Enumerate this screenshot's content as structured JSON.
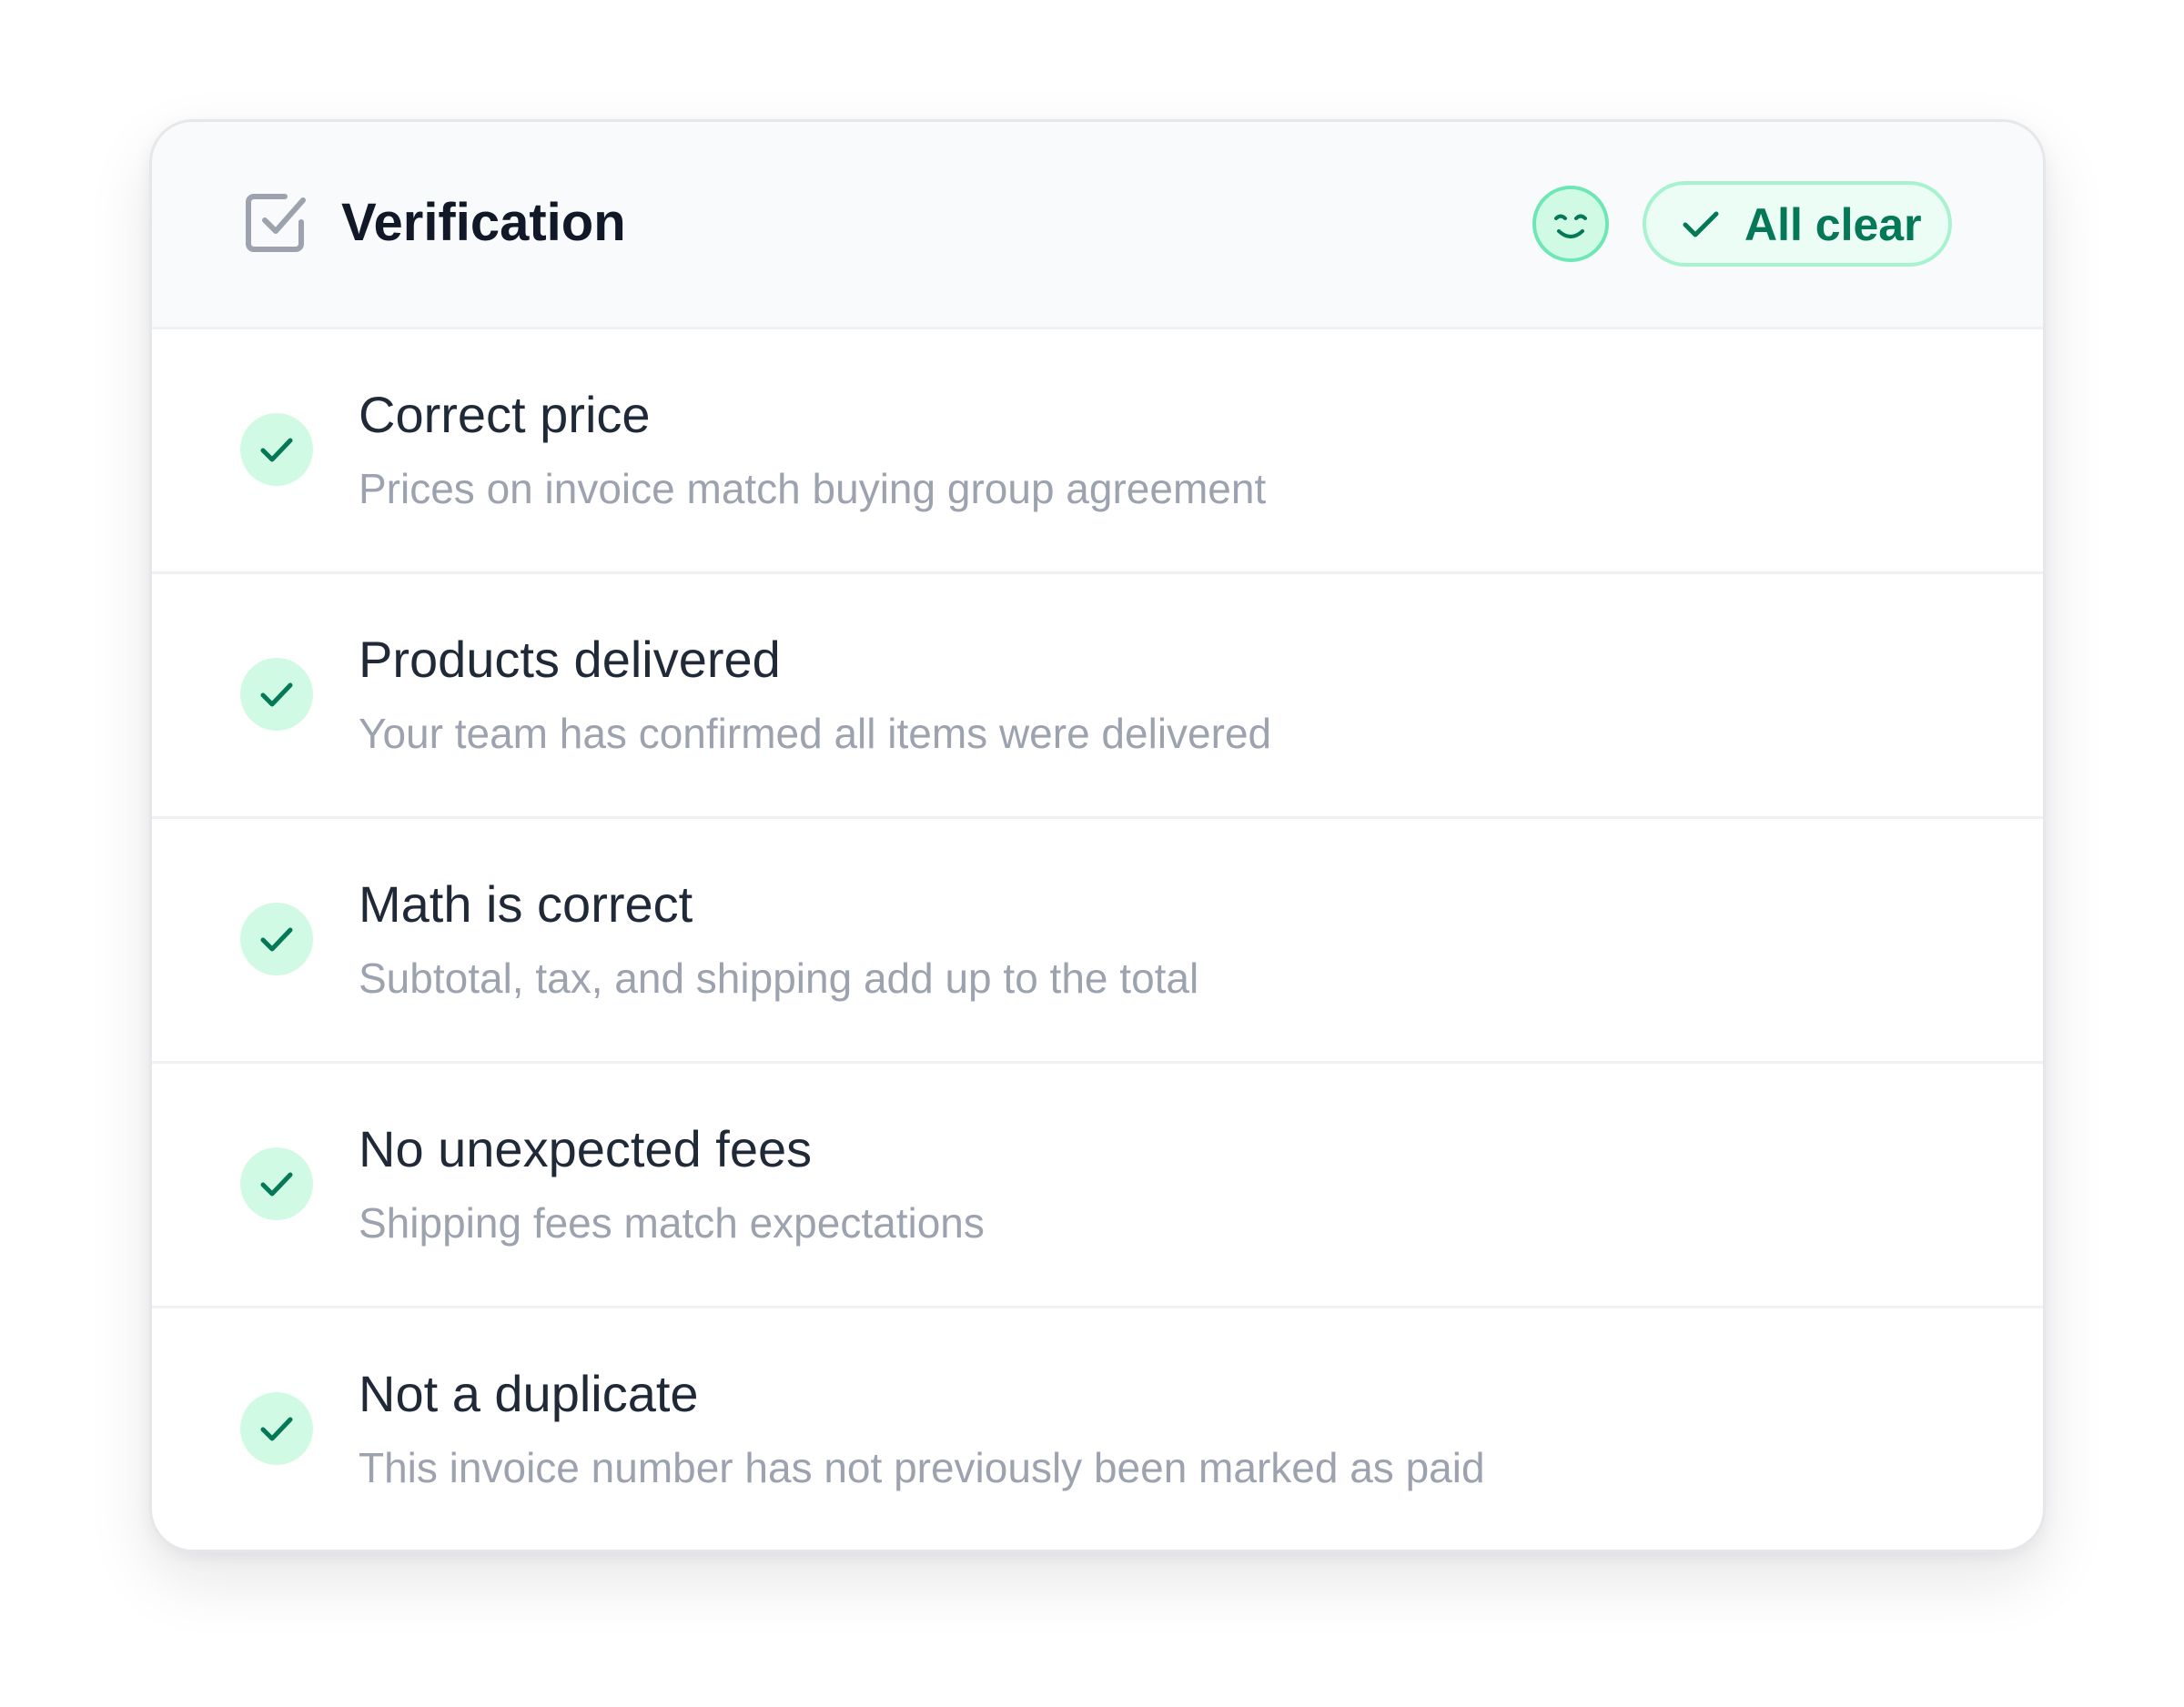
{
  "header": {
    "title": "Verification",
    "title_icon": "checkbox-checked-icon",
    "mood_icon": "smiling-face-icon",
    "status_icon": "check-icon",
    "status_label": "All clear"
  },
  "checks": [
    {
      "icon": "check-circle-icon",
      "status": "passed",
      "title": "Correct price",
      "description": "Prices on invoice match buying group agreement"
    },
    {
      "icon": "check-circle-icon",
      "status": "passed",
      "title": "Products delivered",
      "description": "Your team has confirmed all items were delivered"
    },
    {
      "icon": "check-circle-icon",
      "status": "passed",
      "title": "Math is correct",
      "description": "Subtotal, tax, and shipping add up to the total"
    },
    {
      "icon": "check-circle-icon",
      "status": "passed",
      "title": "No unexpected fees",
      "description": "Shipping fees match expectations"
    },
    {
      "icon": "check-circle-icon",
      "status": "passed",
      "title": "Not a duplicate",
      "description": "This invoice number has not previously been marked as paid"
    }
  ],
  "colors": {
    "success_text": "#047857",
    "success_bg": "#d1fae5",
    "success_border": "#a7f3d0",
    "title_text": "#111827",
    "muted_text": "#9ca3af"
  }
}
